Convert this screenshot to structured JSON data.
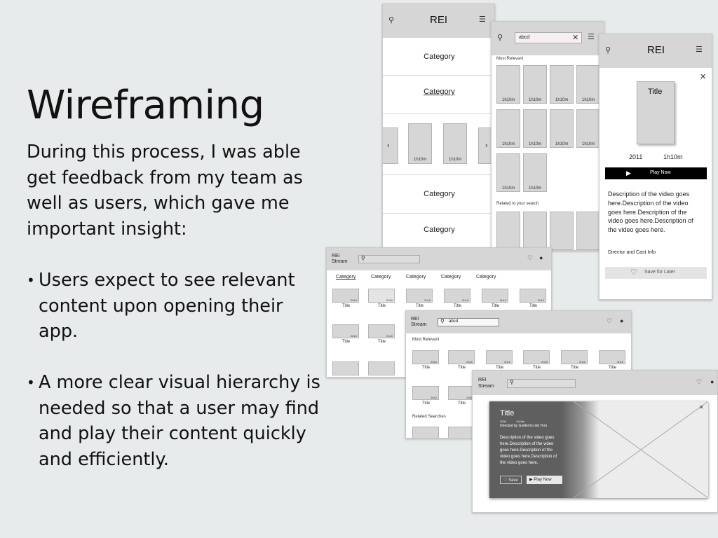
{
  "slide": {
    "title": "Wireframing",
    "intro": "During this process, I was able get feedback from my team as well as users, which gave me important insight:",
    "bullets": [
      "Users expect to see relevant content upon opening their app.",
      "A more clear visual hierarchy is needed so that a user may find and play their content quickly and efficiently."
    ]
  },
  "phone1": {
    "brand": "REI",
    "categories": [
      "Category",
      "Category",
      "Category",
      "Category"
    ],
    "thumb_label": "1h10m"
  },
  "phone2": {
    "search_value": "abcd",
    "most_relevant": "Most Relevant",
    "related": "Related to your search",
    "thumb_label": "1h10m"
  },
  "phone3": {
    "brand": "REI",
    "poster_title": "Title",
    "year": "2011",
    "duration": "1h10m",
    "play": "Play Now",
    "description": "Description of the video goes here.Description of the video goes here.Description of the video goes here.Description of the video goes here.",
    "director": "Director and Cast Info",
    "save": "Save for Later"
  },
  "desk1": {
    "brand": "REI Stream",
    "categories": [
      "Category",
      "Category",
      "Category",
      "Category",
      "Category"
    ],
    "thumb_title": "Title",
    "thumb_meta": "2h10"
  },
  "desk2": {
    "brand": "REI Stream",
    "search_value": "abcd",
    "most_relevant": "Most Relevant",
    "related": "Related Searches",
    "thumb_title": "Title",
    "thumb_meta": "2h10"
  },
  "desk3": {
    "brand": "REI Stream",
    "modal_title": "Title",
    "modal_year": "2009",
    "modal_length": "1h10m",
    "director": "Directed by Guillermo del Toro",
    "description": "Description of the video goes here.Description of the video goes here.Description of the video goes here.Description of the video goes here.",
    "save": "Save",
    "play": "Play Now"
  }
}
